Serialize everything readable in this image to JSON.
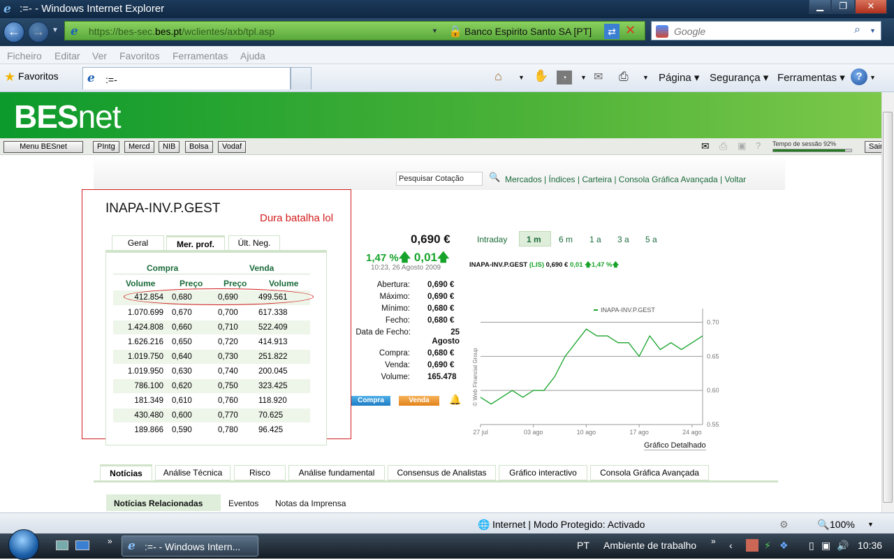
{
  "window": {
    "title": ":=- - Windows Internet Explorer",
    "minimize": "▁",
    "maximize": "❐",
    "close": "✕"
  },
  "address": {
    "url_prefix": "https://bes-sec.",
    "url_domain": "bes.pt",
    "url_path": "/wclientes/axb/tpl.asp",
    "cert_label": "Banco Espirito Santo SA [PT]"
  },
  "search": {
    "placeholder": "Google"
  },
  "menu": [
    "Ficheiro",
    "Editar",
    "Ver",
    "Favoritos",
    "Ferramentas",
    "Ajuda"
  ],
  "favorites": {
    "label": "Favoritos"
  },
  "tab": {
    "title": ":=-"
  },
  "commandbar": {
    "page": "Página ▾",
    "security": "Segurança ▾",
    "tools": "Ferramentas ▾"
  },
  "besnet": {
    "logo_bold": "BES",
    "logo_light": "net",
    "menu_button": "Menu BESnet",
    "quick_buttons": [
      "PIntg",
      "Mercd",
      "NIB",
      "Bolsa",
      "Vodaf"
    ],
    "session_label": "Tempo de sessão 92%",
    "session_pct": 0.92,
    "logout": "Sair"
  },
  "toplinks": {
    "search_value": "Pesquisar Cotação",
    "links": [
      "Mercados",
      "Índices",
      "Carteira",
      "Consola Gráfica Avançada",
      "Voltar"
    ]
  },
  "stock": {
    "name": "INAPA-INV.P.GEST",
    "annotation": "Dura batalha lol",
    "price": "0,690 €",
    "change_pct": "1,47 %",
    "change_abs": "0,01",
    "timestamp": "10:23, 26 Agosto 2009",
    "details": [
      {
        "label": "Abertura:",
        "value": "0,690 €"
      },
      {
        "label": "Máximo:",
        "value": "0,690 €"
      },
      {
        "label": "Mínimo:",
        "value": "0,680 €"
      },
      {
        "label": "Fecho:",
        "value": "0,680 €"
      },
      {
        "label": "Data de Fecho:",
        "value": "25 Agosto"
      },
      {
        "label": "Compra:",
        "value": "0,680 €"
      },
      {
        "label": "Venda:",
        "value": "0,690 €"
      },
      {
        "label": "Volume:",
        "value": "165.478"
      }
    ],
    "buy_button": "Compra",
    "sell_button": "Venda"
  },
  "depth": {
    "tabs": [
      "Geral",
      "Mer. prof.",
      "Últ. Neg."
    ],
    "buy_header": "Compra",
    "sell_header": "Venda",
    "columns": [
      "Volume",
      "Preço",
      "Preço",
      "Volume"
    ],
    "rows": [
      [
        "412.854",
        "0,680",
        "0,690",
        "499.561"
      ],
      [
        "1.070.699",
        "0,670",
        "0,700",
        "617.338"
      ],
      [
        "1.424.808",
        "0,660",
        "0,710",
        "522.409"
      ],
      [
        "1.626.216",
        "0,650",
        "0,720",
        "414.913"
      ],
      [
        "1.019.750",
        "0,640",
        "0,730",
        "251.822"
      ],
      [
        "1.019.950",
        "0,630",
        "0,740",
        "200.045"
      ],
      [
        "786.100",
        "0,620",
        "0,750",
        "323.425"
      ],
      [
        "181.349",
        "0,610",
        "0,760",
        "118.920"
      ],
      [
        "430.480",
        "0,600",
        "0,770",
        "70.625"
      ],
      [
        "189.866",
        "0,590",
        "0,780",
        "96.425"
      ]
    ]
  },
  "chart": {
    "periods": [
      "Intraday",
      "1 m",
      "6 m",
      "1 a",
      "3 a",
      "5 a"
    ],
    "active_period": "1 m",
    "title_name": "INAPA-INV.P.GEST",
    "title_market": "(LIS)",
    "title_price": "0,690 €",
    "title_change": "0,01",
    "title_pct": "1,47 %",
    "legend": "INAPA-INV.P.GEST",
    "credit": "© Web Financial Group",
    "detail_link": "Gráfico Detalhado"
  },
  "chart_data": {
    "type": "line",
    "title": "",
    "xlabel": "",
    "ylabel": "",
    "x_ticks": [
      "27 jul",
      "03 ago",
      "10 ago",
      "17 ago",
      "24 ago"
    ],
    "y_ticks": [
      0.55,
      0.6,
      0.65,
      0.7
    ],
    "ylim": [
      0.55,
      0.72
    ],
    "grid": true,
    "legend": "top",
    "series": [
      {
        "name": "INAPA-INV.P.GEST",
        "x": [
          "27 jul",
          "28 jul",
          "29 jul",
          "30 jul",
          "31 jul",
          "03 ago",
          "04 ago",
          "05 ago",
          "06 ago",
          "07 ago",
          "10 ago",
          "11 ago",
          "12 ago",
          "13 ago",
          "14 ago",
          "17 ago",
          "18 ago",
          "19 ago",
          "20 ago",
          "21 ago",
          "24 ago",
          "25 ago"
        ],
        "values": [
          0.59,
          0.58,
          0.59,
          0.6,
          0.59,
          0.6,
          0.6,
          0.62,
          0.65,
          0.67,
          0.69,
          0.68,
          0.68,
          0.67,
          0.67,
          0.65,
          0.68,
          0.66,
          0.67,
          0.66,
          0.67,
          0.68
        ]
      }
    ]
  },
  "bottom_tabs": [
    "Notícias",
    "Análise Técnica",
    "Risco",
    "Análise fundamental",
    "Consensus de Analistas",
    "Gráfico interactivo",
    "Consola Gráfica Avançada"
  ],
  "news_tabs": [
    "Notícias Relacionadas",
    "Eventos",
    "Notas da Imprensa"
  ],
  "statusbar": {
    "zone": "Internet | Modo Protegido: Activado",
    "zoom": "100%"
  },
  "taskbar": {
    "task": ":=- - Windows Intern...",
    "lang": "PT",
    "desktop": "Ambiente de trabalho",
    "clock": "10:36"
  }
}
